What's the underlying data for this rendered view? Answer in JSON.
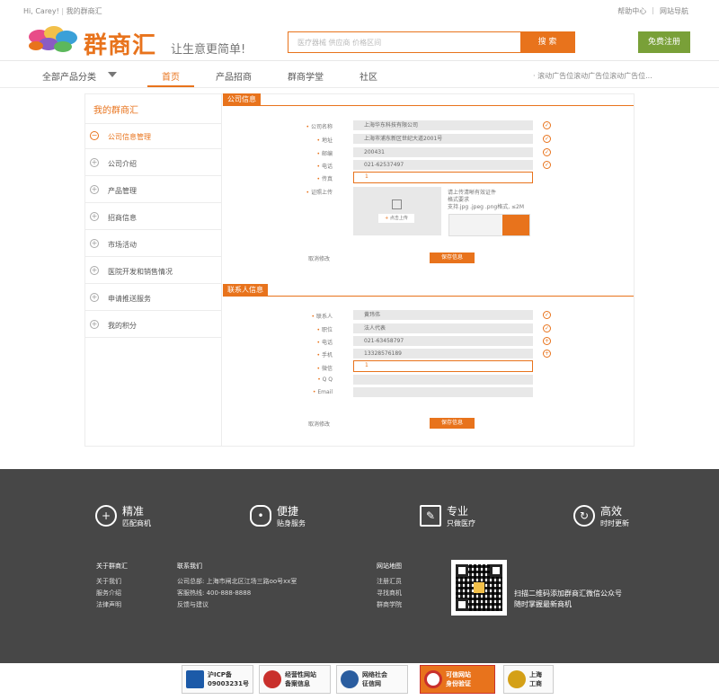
{
  "topbar": {
    "greeting": "Hi, Carey!",
    "my": "我的群商汇",
    "help": "帮助中心",
    "sitemap": "网站导航"
  },
  "header": {
    "brand": "群商汇",
    "slogan": "让生意更简单!",
    "search_placeholder": "医疗器械  供应商  价格区间",
    "search_button": "搜  索",
    "register": "免费注册"
  },
  "nav": {
    "category": "全部产品分类",
    "items": [
      "首页",
      "产品招商",
      "群商学堂",
      "社区"
    ],
    "ad": "· 滚动广告位滚动广告位滚动广告位..."
  },
  "sidebar": {
    "title": "我的群商汇",
    "items": [
      {
        "icon": "minus-circle-icon",
        "label": "公司信息管理"
      },
      {
        "icon": "plus-circle-icon",
        "label": "公司介绍"
      },
      {
        "icon": "plus-circle-icon",
        "label": "产品管理"
      },
      {
        "icon": "plus-circle-icon",
        "label": "招商信息"
      },
      {
        "icon": "plus-circle-icon",
        "label": "市场活动"
      },
      {
        "icon": "plus-circle-icon",
        "label": "医院开发和销售情况"
      },
      {
        "icon": "plus-circle-icon",
        "label": "申请推送服务"
      },
      {
        "icon": "plus-circle-icon",
        "label": "我的积分"
      }
    ]
  },
  "company": {
    "title": "公司信息",
    "fields": [
      {
        "label": "公司名称",
        "value": "上海华东科技有限公司"
      },
      {
        "label": "地址",
        "value": "上海市浦东新区世纪大道2001号"
      },
      {
        "label": "邮编",
        "value": "200431"
      },
      {
        "label": "电话",
        "value": "021-62537497"
      },
      {
        "label": "传真",
        "value": "1"
      }
    ],
    "cert_label": "证照上传",
    "upload_button": "点击上传",
    "upload_tip": [
      "请上传清晰有效证件",
      "格式要求",
      "支持.jpg .jpeg .png格式, ≤2M"
    ],
    "cancel": "取消修改",
    "save": "保存信息"
  },
  "contact": {
    "title": "联系人信息",
    "fields": [
      {
        "label": "联系人",
        "value": "黄玮伟"
      },
      {
        "label": "职位",
        "value": "法人代表"
      },
      {
        "label": "电话",
        "value": "021-63458797"
      },
      {
        "label": "手机",
        "value": "13328576189"
      },
      {
        "label": "微信",
        "value": "1"
      },
      {
        "label": "Q Q",
        "value": ""
      },
      {
        "label": "Email",
        "value": ""
      }
    ],
    "cancel": "取消修改",
    "save": "保存信息"
  },
  "footer": {
    "features": [
      {
        "icon": "search-plus-icon",
        "title": "精准",
        "sub": "匹配商机"
      },
      {
        "icon": "wechat-icon",
        "title": "便捷",
        "sub": "贴身服务"
      },
      {
        "icon": "edit-icon",
        "title": "专业",
        "sub": "只做医疗"
      },
      {
        "icon": "refresh-icon",
        "title": "高效",
        "sub": "时时更新"
      }
    ],
    "about": {
      "heading": "关于群商汇",
      "links": [
        "关于我们",
        "服务介绍",
        "法律声明"
      ]
    },
    "contact": {
      "heading": "联系我们",
      "lines": [
        "公司总部: 上海市闸北区江场三路oo号xx室",
        "客服热线: 400-888-8888",
        "反馈与建议"
      ]
    },
    "sitemap": {
      "heading": "网站地图",
      "links": [
        "注册汇员",
        "寻找商机",
        "群商学院"
      ]
    },
    "qr_text": [
      "扫描二维码添加群商汇微信公众号",
      "随时掌握最新商机"
    ]
  },
  "badges": [
    {
      "line1": "沪ICP备",
      "line2": "09003231号"
    },
    {
      "line1": "经营性网站",
      "line2": "备案信息"
    },
    {
      "line1": "网络社会",
      "line2": "征信网"
    },
    {
      "line1": "可信网站",
      "line2": "身份验证"
    },
    {
      "line1": "上海",
      "line2": "工商"
    }
  ],
  "colors": {
    "accent": "#e8731c",
    "green": "#79a038",
    "footer": "#474747"
  }
}
